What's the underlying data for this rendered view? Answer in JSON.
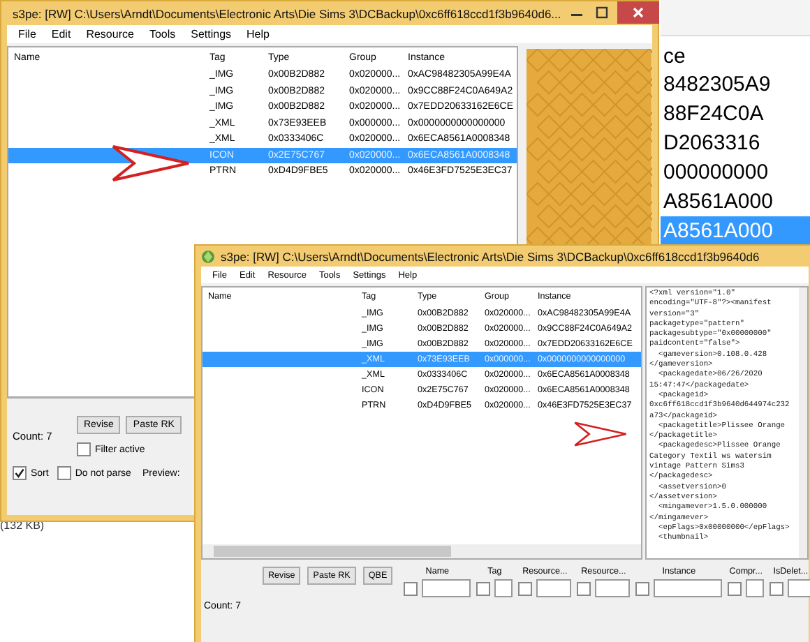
{
  "background_window": {
    "column_header": "ce",
    "rows": [
      {
        "text": "8482305A9",
        "selected": false
      },
      {
        "text": "88F24C0A",
        "selected": false
      },
      {
        "text": "D2063316",
        "selected": false
      },
      {
        "text": "000000000",
        "selected": false
      },
      {
        "text": "A8561A000",
        "selected": false
      },
      {
        "text": "A8561A000",
        "selected": true
      }
    ]
  },
  "background_text": "(132 KB)",
  "back_window": {
    "title": "s3pe: [RW] C:\\Users\\Arndt\\Documents\\Electronic Arts\\Die Sims 3\\DCBackup\\0xc6ff618ccd1f3b9640d6...",
    "menu": [
      "File",
      "Edit",
      "Resource",
      "Tools",
      "Settings",
      "Help"
    ],
    "columns": [
      "Name",
      "Tag",
      "Type",
      "Group",
      "Instance"
    ],
    "rows": [
      {
        "tag": "_IMG",
        "type": "0x00B2D882",
        "group": "0x020000...",
        "instance": "0xAC98482305A99E4A",
        "selected": false
      },
      {
        "tag": "_IMG",
        "type": "0x00B2D882",
        "group": "0x020000...",
        "instance": "0x9CC88F24C0A649A2",
        "selected": false
      },
      {
        "tag": "_IMG",
        "type": "0x00B2D882",
        "group": "0x020000...",
        "instance": "0x7EDD20633162E6CE",
        "selected": false
      },
      {
        "tag": "_XML",
        "type": "0x73E93EEB",
        "group": "0x000000...",
        "instance": "0x0000000000000000",
        "selected": false
      },
      {
        "tag": "_XML",
        "type": "0x0333406C",
        "group": "0x020000...",
        "instance": "0x6ECA8561A0008348",
        "selected": false
      },
      {
        "tag": "ICON",
        "type": "0x2E75C767",
        "group": "0x020000...",
        "instance": "0x6ECA8561A0008348",
        "selected": true
      },
      {
        "tag": "PTRN",
        "type": "0xD4D9FBE5",
        "group": "0x020000...",
        "instance": "0x46E3FD7525E3EC37",
        "selected": false
      }
    ],
    "preview": {
      "kind": "picture"
    },
    "buttons": [
      "Revise",
      "Paste RK"
    ],
    "count": "Count: 7",
    "checkboxes": [
      {
        "label": "Filter active",
        "checked": false
      },
      {
        "label": "Sort",
        "checked": true
      },
      {
        "label": "Do not parse",
        "checked": false
      }
    ],
    "preview_label": "Preview:"
  },
  "front_window": {
    "title": "s3pe: [RW] C:\\Users\\Arndt\\Documents\\Electronic Arts\\Die Sims 3\\DCBackup\\0xc6ff618ccd1f3b9640d6",
    "menu": [
      "File",
      "Edit",
      "Resource",
      "Tools",
      "Settings",
      "Help"
    ],
    "columns": [
      "Name",
      "Tag",
      "Type",
      "Group",
      "Instance"
    ],
    "rows": [
      {
        "tag": "_IMG",
        "type": "0x00B2D882",
        "group": "0x020000...",
        "instance": "0xAC98482305A99E4A",
        "selected": false
      },
      {
        "tag": "_IMG",
        "type": "0x00B2D882",
        "group": "0x020000...",
        "instance": "0x9CC88F24C0A649A2",
        "selected": false
      },
      {
        "tag": "_IMG",
        "type": "0x00B2D882",
        "group": "0x020000...",
        "instance": "0x7EDD20633162E6CE",
        "selected": false
      },
      {
        "tag": "_XML",
        "type": "0x73E93EEB",
        "group": "0x000000...",
        "instance": "0x0000000000000000",
        "selected": true
      },
      {
        "tag": "_XML",
        "type": "0x0333406C",
        "group": "0x020000...",
        "instance": "0x6ECA8561A0008348",
        "selected": false
      },
      {
        "tag": "ICON",
        "type": "0x2E75C767",
        "group": "0x020000...",
        "instance": "0x6ECA8561A0008348",
        "selected": false
      },
      {
        "tag": "PTRN",
        "type": "0xD4D9FBE5",
        "group": "0x020000...",
        "instance": "0x46E3FD7525E3EC37",
        "selected": false
      }
    ],
    "xml_lines": [
      "<?xml version=\"1.0\"",
      "encoding=\"UTF-8\"?><manifest",
      "version=\"3\"",
      "packagetype=\"pattern\"",
      "packagesubtype=\"0x00000000\"",
      "paidcontent=\"false\">",
      "  <gameversion>0.108.0.428",
      "</gameversion>",
      "  <packagedate>06/26/2020",
      "15:47:47</packagedate>",
      "  <packageid>",
      "0xc6ff618ccd1f3b9640d644974c232",
      "a73</packageid>",
      "  <packagetitle>Plissee Orange",
      "</packagetitle>",
      "  <packagedesc>Plissee Orange",
      "Category Textil ws watersim",
      "vintage Pattern Sims3",
      "</packagedesc>",
      "  <assetversion>0",
      "</assetversion>",
      "  <mingamever>1.5.0.000000",
      "</mingamever>",
      "  <epFlags>0x00000000</epFlags>",
      "  <thumbnail>"
    ],
    "buttons": [
      "Revise",
      "Paste RK",
      "QBE"
    ],
    "count": "Count: 7",
    "filters": [
      {
        "label": "Name",
        "checked": false
      },
      {
        "label": "Tag",
        "checked": false
      },
      {
        "label": "Resource...",
        "checked": false
      },
      {
        "label": "Resource...",
        "checked": false
      },
      {
        "label": "Instance",
        "checked": false
      },
      {
        "label": "Compr...",
        "checked": false
      },
      {
        "label": "IsDelet...",
        "checked": false
      }
    ]
  }
}
